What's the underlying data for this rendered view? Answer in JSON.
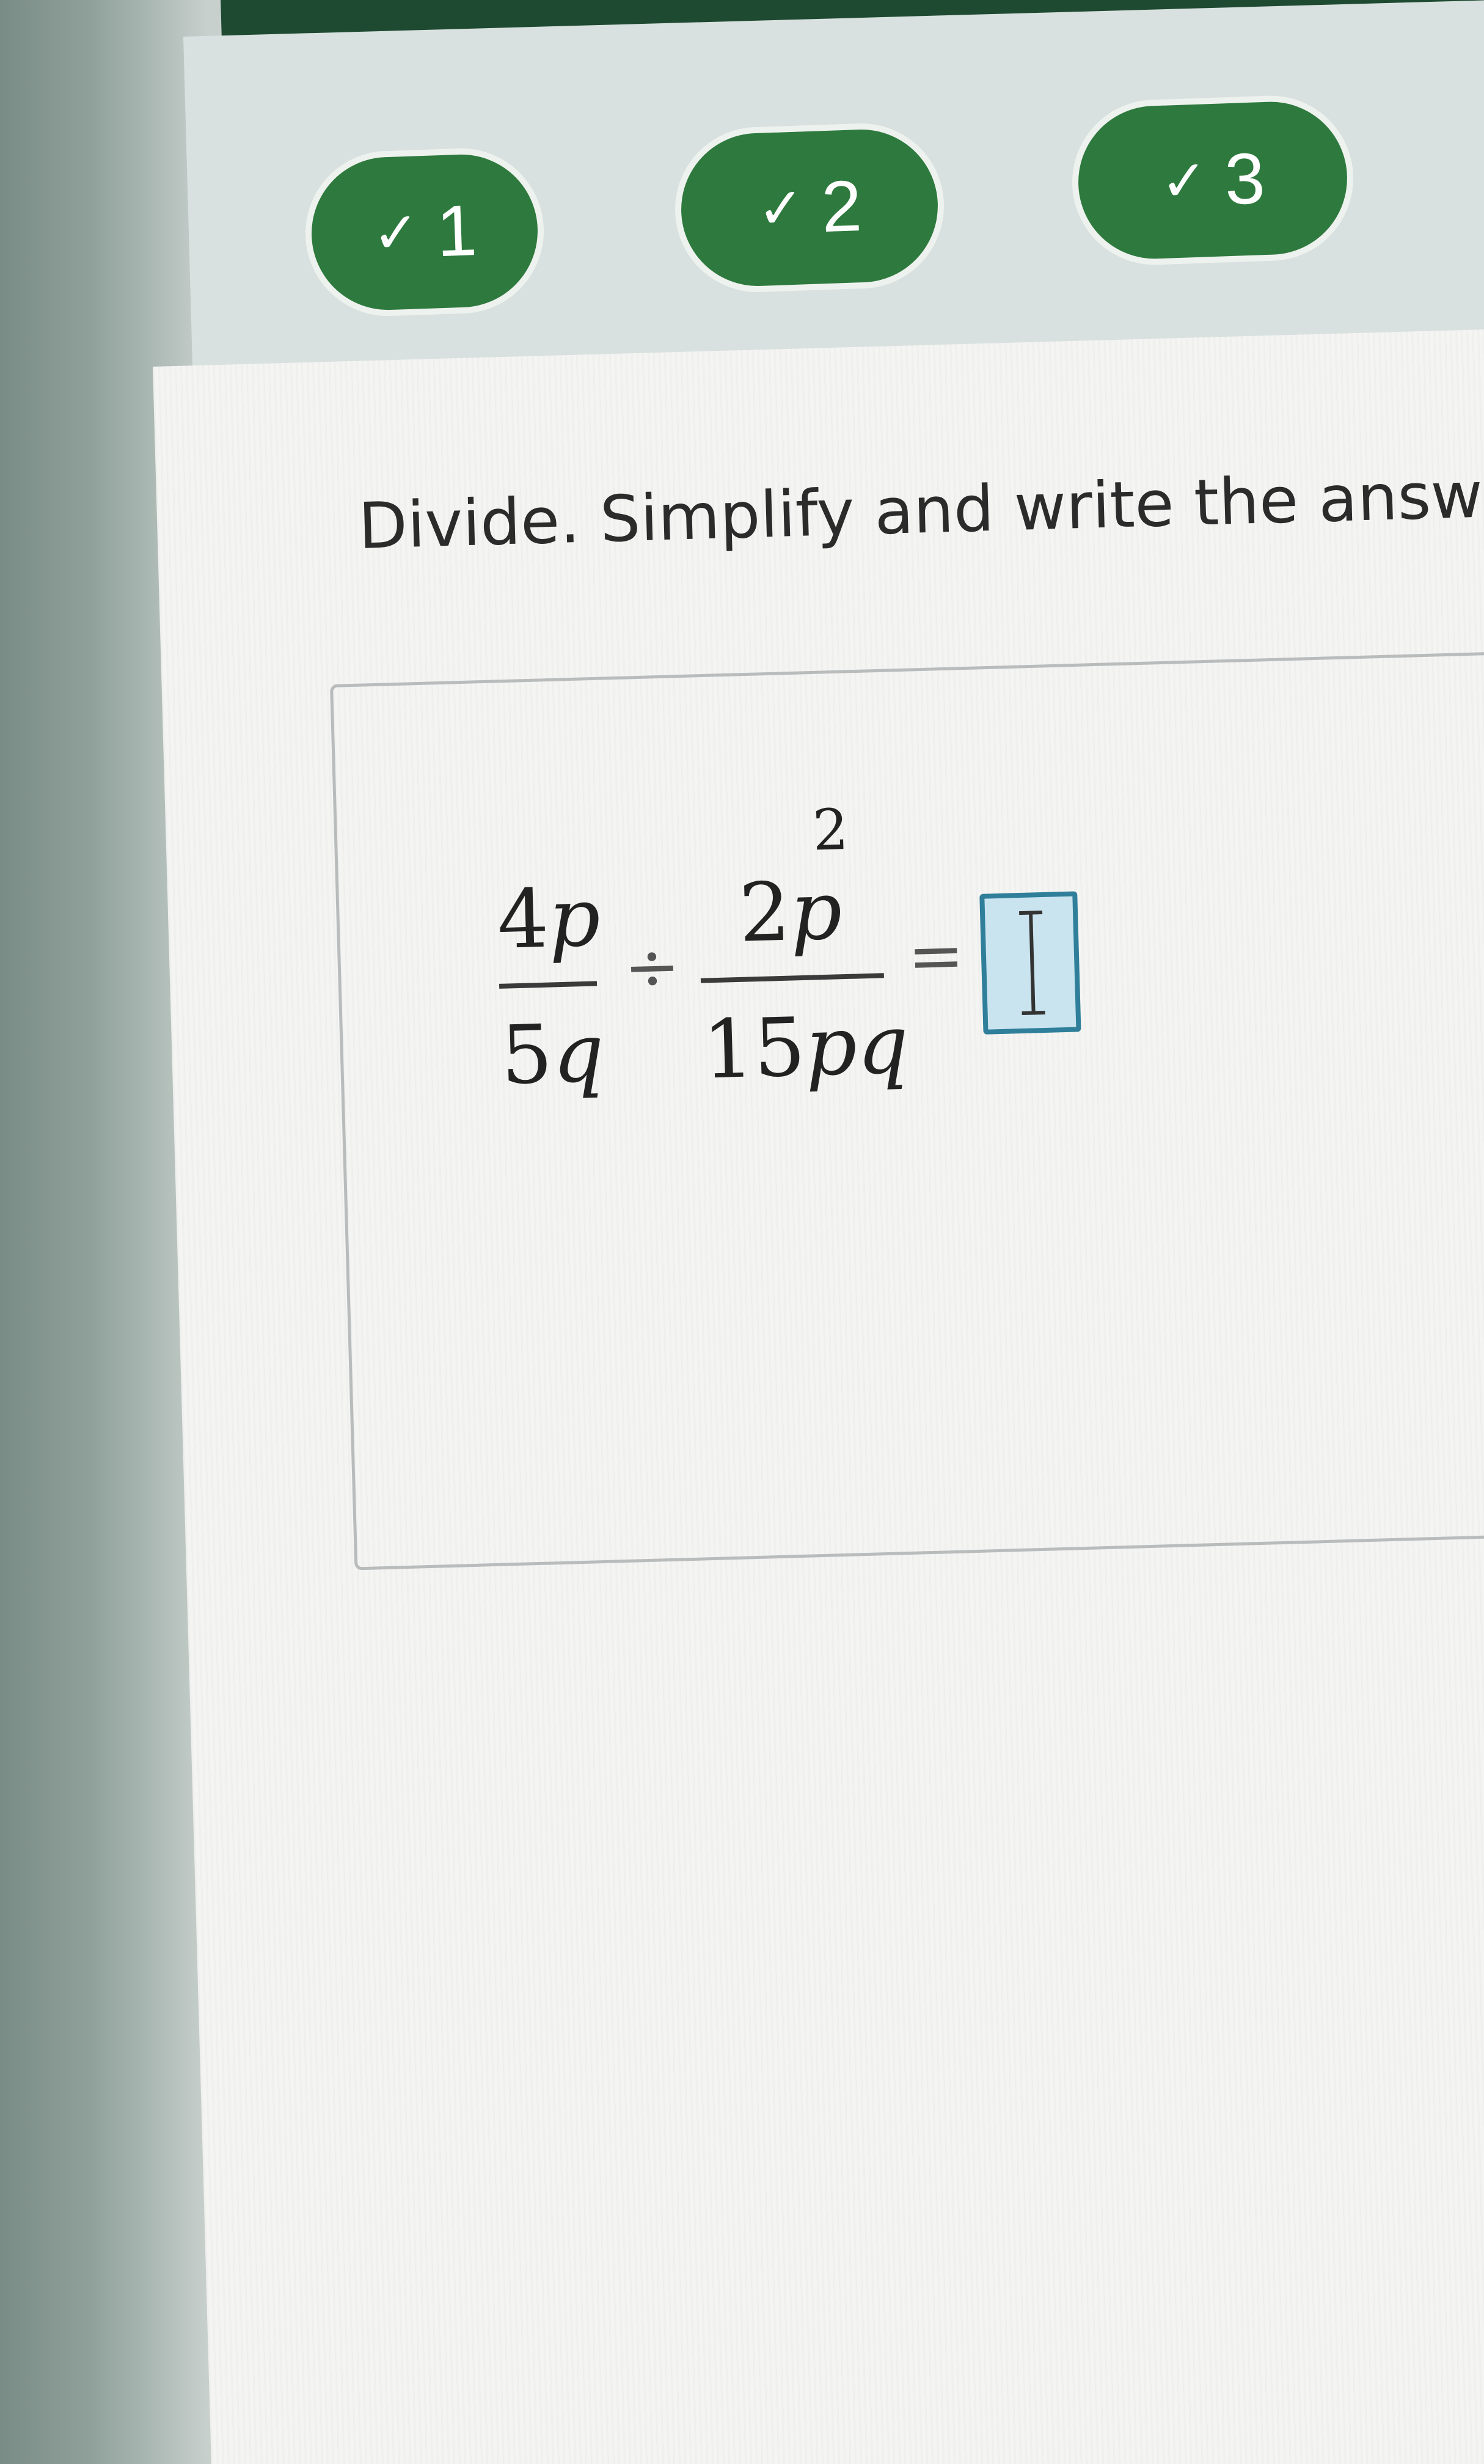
{
  "progress": {
    "steps": [
      {
        "label": "1",
        "icon": "check-icon",
        "status": "completed"
      },
      {
        "label": "2",
        "icon": "check-icon",
        "status": "completed"
      },
      {
        "label": "3",
        "icon": "check-icon",
        "status": "completed"
      }
    ]
  },
  "question": {
    "prompt": "Divide. Simplify and write the answer"
  },
  "expression": {
    "fraction1": {
      "numerator_coef": "4",
      "numerator_var": "p",
      "denominator_coef": "5",
      "denominator_var": "q"
    },
    "operator": "÷",
    "fraction2": {
      "numerator_coef": "2",
      "numerator_var": "p",
      "numerator_exponent": "2",
      "denominator_coef": "15",
      "denominator_var": "pq"
    },
    "equals": "="
  },
  "answer": {
    "value": ""
  },
  "colors": {
    "step_complete": "#2e7a3e",
    "header_bar": "#1f4a32",
    "answer_box_fill": "#c9e4ef",
    "answer_box_border": "#2f7f9a"
  }
}
